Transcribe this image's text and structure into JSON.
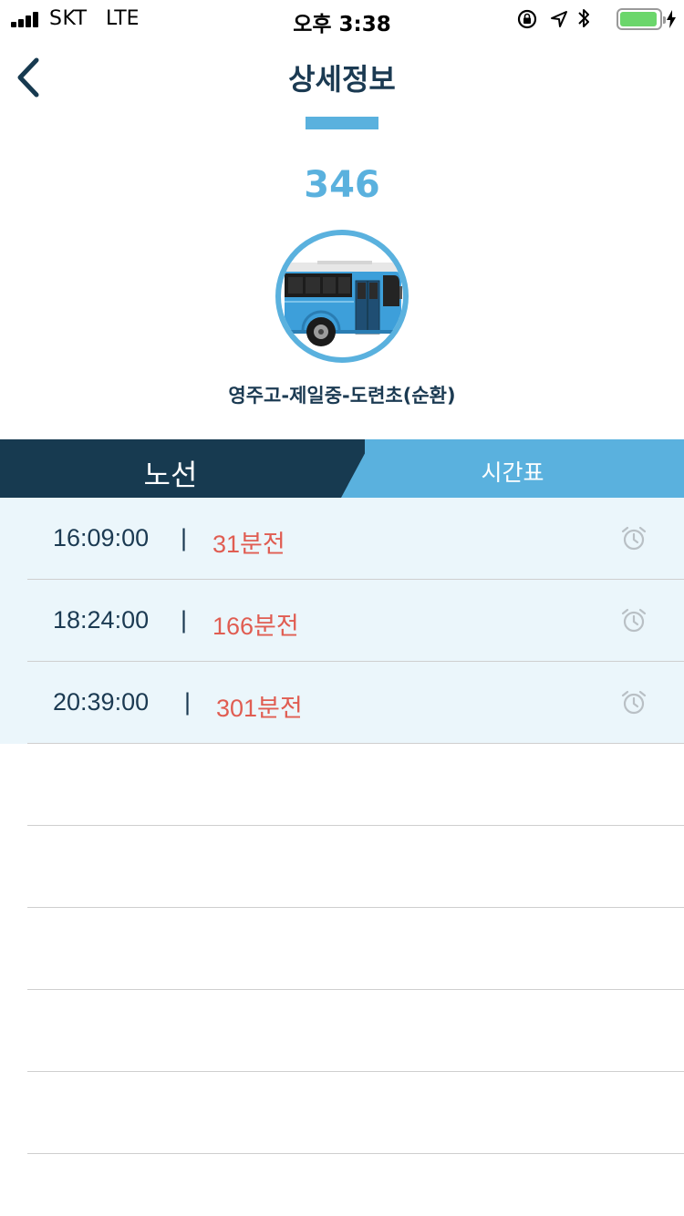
{
  "status_bar": {
    "carrier": "SKT",
    "network": "LTE",
    "time": "오후 3:38",
    "battery_level": 0.95,
    "icons": [
      "orientation-lock-icon",
      "location-arrow-icon",
      "bluetooth-icon",
      "battery-icon",
      "charging-bolt-icon"
    ]
  },
  "header": {
    "back_icon": "chevron-left-icon",
    "title": "상세정보"
  },
  "bus": {
    "number": "346",
    "image": "bus-icon",
    "route": "영주고-제일중-도련초(순환)"
  },
  "tabs": [
    {
      "label": "노선",
      "active": false
    },
    {
      "label": "시간표",
      "active": true
    }
  ],
  "timetable": [
    {
      "time": "16:09:00",
      "separator": "|",
      "remaining": "31분전"
    },
    {
      "time": "18:24:00",
      "separator": "|",
      "remaining": "166분전"
    },
    {
      "time": "20:39:00",
      "separator": "|",
      "remaining": "301분전"
    }
  ],
  "empty_rows": 5,
  "colors": {
    "accent": "#5ab1de",
    "navy": "#173a50",
    "text": "#1b3a52",
    "remaining": "#e05d52",
    "row_highlight": "#ebf6fb"
  }
}
